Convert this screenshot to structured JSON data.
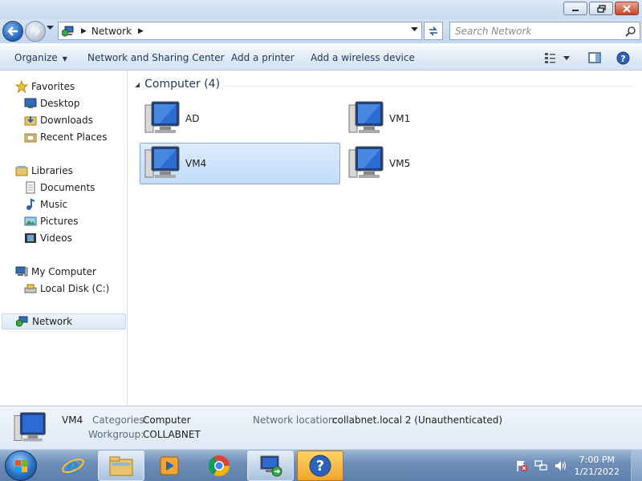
{
  "address": {
    "location": "Network"
  },
  "search": {
    "placeholder": "Search Network"
  },
  "commands": {
    "organize": "Organize",
    "network_sharing": "Network and Sharing Center",
    "add_printer": "Add a printer",
    "add_wireless": "Add a wireless device"
  },
  "nav": {
    "favorites": "Favorites",
    "desktop": "Desktop",
    "downloads": "Downloads",
    "recent": "Recent Places",
    "libraries": "Libraries",
    "documents": "Documents",
    "music": "Music",
    "pictures": "Pictures",
    "videos": "Videos",
    "mycomputer": "My Computer",
    "localdisk": "Local Disk (C:)",
    "network": "Network"
  },
  "group": {
    "title": "Computer (4)"
  },
  "computers": [
    "AD",
    "VM1",
    "VM4",
    "VM5"
  ],
  "details": {
    "name": "VM4",
    "categories_label": "Categories:",
    "categories_value": "Computer",
    "workgroup_label": "Workgroup:",
    "workgroup_value": "COLLABNET",
    "netloc_label": "Network location:",
    "netloc_value": "collabnet.local  2 (Unauthenticated)"
  },
  "clock": {
    "time": "7:00 PM",
    "date": "1/21/2022"
  },
  "colors": {
    "selection": "#c1dcfb",
    "accent": "#1e395b"
  }
}
